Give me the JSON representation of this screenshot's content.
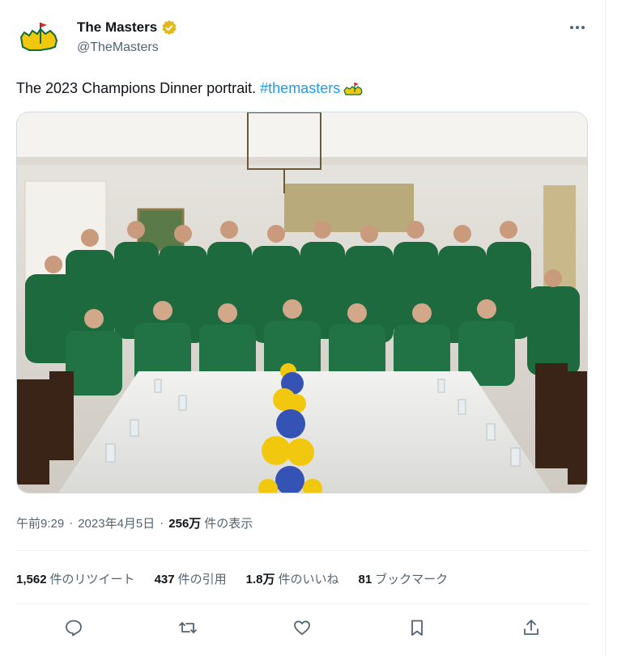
{
  "account": {
    "display_name": "The Masters",
    "handle": "@TheMasters",
    "verified": true,
    "avatar_icon": "masters-logo-icon"
  },
  "tweet": {
    "text": "The 2023 Champions Dinner portrait.",
    "hashtag": "#themasters",
    "hashtag_emoji_icon": "masters-flag-emoji-icon",
    "image_icon": "champions-dinner-photo"
  },
  "meta": {
    "time": "午前9:29",
    "date": "2023年4月5日",
    "views_count": "256万",
    "views_label": "件の表示"
  },
  "stats": {
    "retweets_count": "1,562",
    "retweets_label": "件のリツイート",
    "quotes_count": "437",
    "quotes_label": "件の引用",
    "likes_count": "1.8万",
    "likes_label": "件のいいね",
    "bookmarks_count": "81",
    "bookmarks_label": "ブックマーク"
  },
  "colors": {
    "accent": "#1d9bf0",
    "text": "#0f1419",
    "secondary": "#536471",
    "verified_gold": "#e2b719",
    "masters_green": "#0c6b3c",
    "masters_yellow": "#f2c80f"
  },
  "actions": [
    "reply-icon",
    "retweet-icon",
    "like-icon",
    "bookmark-icon",
    "share-icon"
  ]
}
